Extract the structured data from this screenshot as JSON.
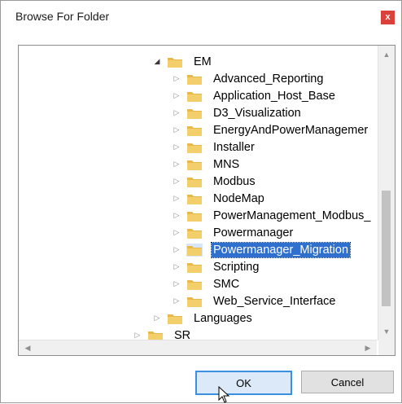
{
  "window": {
    "title": "Browse For Folder",
    "close_glyph": "x"
  },
  "tree": {
    "items": [
      {
        "label": "EM",
        "expanded": true
      },
      {
        "label": "Advanced_Reporting"
      },
      {
        "label": "Application_Host_Base"
      },
      {
        "label": "D3_Visualization"
      },
      {
        "label": "EnergyAndPowerManagemer"
      },
      {
        "label": "Installer"
      },
      {
        "label": "MNS"
      },
      {
        "label": "Modbus"
      },
      {
        "label": "NodeMap"
      },
      {
        "label": "PowerManagement_Modbus_"
      },
      {
        "label": "Powermanager"
      },
      {
        "label": "Powermanager_Migration",
        "selected": true
      },
      {
        "label": "Scripting"
      },
      {
        "label": "SMC"
      },
      {
        "label": "Web_Service_Interface"
      },
      {
        "label": "Languages"
      },
      {
        "label": "SR"
      }
    ]
  },
  "buttons": {
    "ok": "OK",
    "cancel": "Cancel"
  },
  "colors": {
    "selection": "#2f6fce",
    "folder": "#e8b84a",
    "close": "#d9413a",
    "ok_border": "#3b8fe0"
  },
  "icons": {
    "folder": "folder-icon",
    "expand": "expand-arrow-icon",
    "collapse": "collapse-arrow-icon"
  }
}
